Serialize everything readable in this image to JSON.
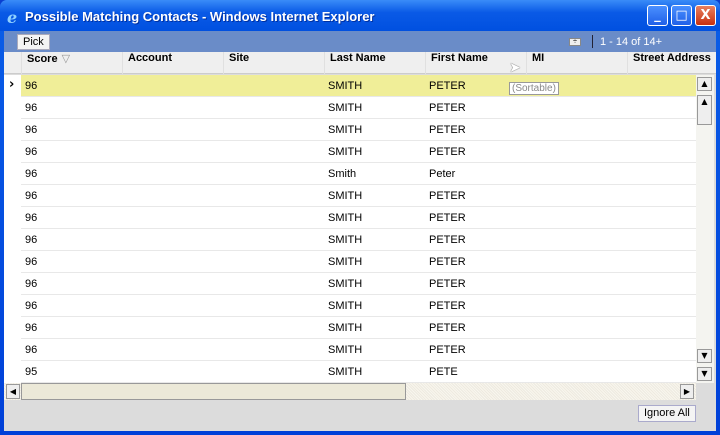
{
  "window": {
    "title": "Possible Matching Contacts - Windows Internet Explorer",
    "minimize": "_",
    "maximize": "□",
    "close": "X"
  },
  "toolbar": {
    "pick_label": "Pick",
    "record_count": "1 - 14 of 14+"
  },
  "columns": [
    "Score",
    "Account",
    "Site",
    "Last Name",
    "First Name",
    "MI",
    "Street Address"
  ],
  "sort_indicator": "▽",
  "tooltip": "(Sortable)",
  "rows": [
    {
      "score": "96",
      "last": "SMITH",
      "first": "PETER"
    },
    {
      "score": "96",
      "last": "SMITH",
      "first": "PETER"
    },
    {
      "score": "96",
      "last": "SMITH",
      "first": "PETER"
    },
    {
      "score": "96",
      "last": "SMITH",
      "first": "PETER"
    },
    {
      "score": "96",
      "last": "Smith",
      "first": "Peter"
    },
    {
      "score": "96",
      "last": "SMITH",
      "first": "PETER"
    },
    {
      "score": "96",
      "last": "SMITH",
      "first": "PETER"
    },
    {
      "score": "96",
      "last": "SMITH",
      "first": "PETER"
    },
    {
      "score": "96",
      "last": "SMITH",
      "first": "PETER"
    },
    {
      "score": "96",
      "last": "SMITH",
      "first": "PETER"
    },
    {
      "score": "96",
      "last": "SMITH",
      "first": "PETER"
    },
    {
      "score": "96",
      "last": "SMITH",
      "first": "PETER"
    },
    {
      "score": "96",
      "last": "SMITH",
      "first": "PETER"
    },
    {
      "score": "95",
      "last": "SMITH",
      "first": "PETE"
    }
  ],
  "footer": {
    "ignore_all_label": "Ignore All"
  }
}
